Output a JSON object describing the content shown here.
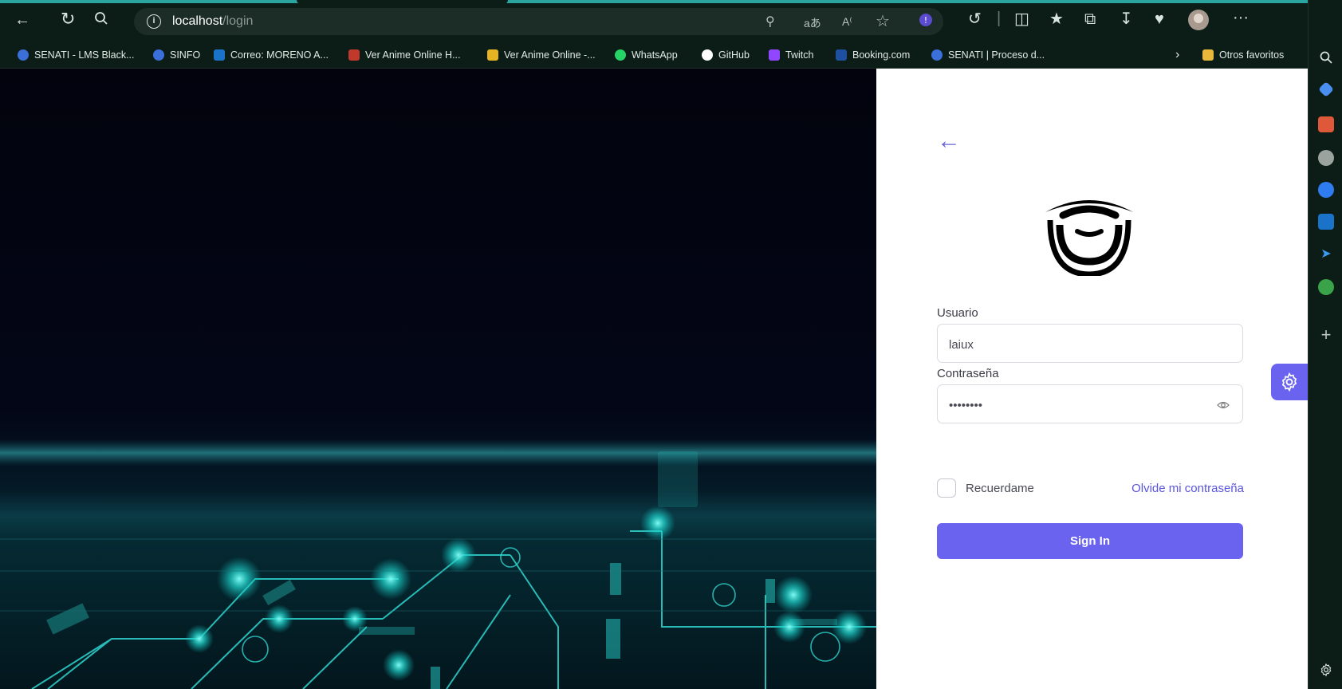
{
  "browser": {
    "url_host": "localhost",
    "url_path": "/login",
    "more_label": "···"
  },
  "bookmarks": [
    {
      "label": "SENATI - LMS Black...",
      "color": "#3b6fd9"
    },
    {
      "label": "SINFO",
      "color": "#3b6fd9"
    },
    {
      "label": "Correo: MORENO A...",
      "color": "#1a73c8"
    },
    {
      "label": "Ver Anime Online H...",
      "color": "#c0392b"
    },
    {
      "label": "Ver Anime Online -...",
      "color": "#e6b422"
    },
    {
      "label": "WhatsApp",
      "color": "#25d366"
    },
    {
      "label": "GitHub",
      "color": "#ffffff"
    },
    {
      "label": "Twitch",
      "color": "#9146ff"
    },
    {
      "label": "Booking.com",
      "color": "#1e4fa0"
    },
    {
      "label": "SENATI | Proceso d...",
      "color": "#3b6fd9"
    }
  ],
  "other_favorites": "Otros favoritos",
  "login": {
    "username_label": "Usuario",
    "username_value": "laiux",
    "password_label": "Contraseña",
    "password_value": "12345678",
    "remember_label": "Recuerdame",
    "forgot_label": "Olvide mi contraseña",
    "signin_label": "Sign In"
  },
  "colors": {
    "accent": "#6a63ef",
    "link": "#5a55e0",
    "browser_bg": "#0c1c16"
  }
}
